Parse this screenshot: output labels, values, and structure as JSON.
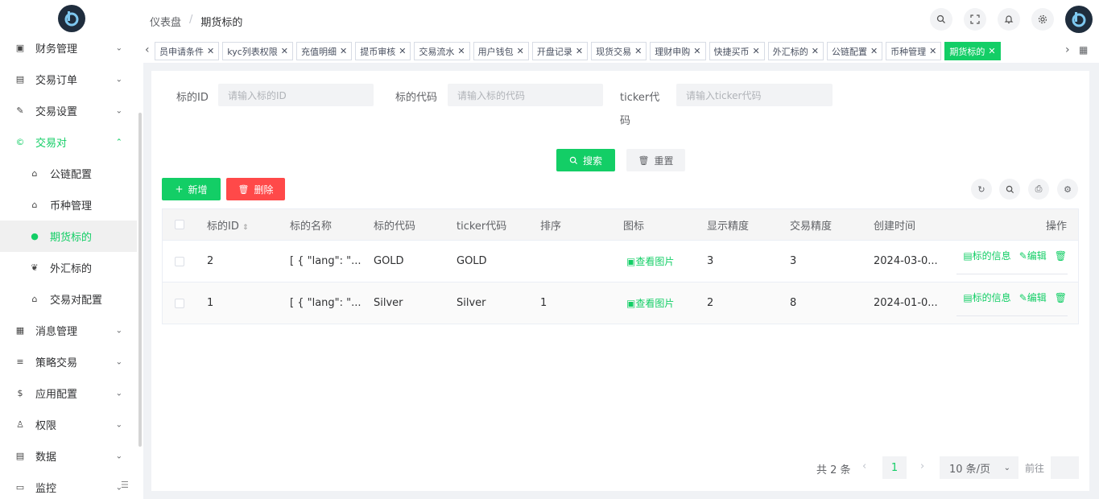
{
  "sidebar": {
    "items": [
      {
        "label": "财务管理",
        "icon": "finance-icon",
        "glyph": "▣"
      },
      {
        "label": "交易订单",
        "icon": "order-icon",
        "glyph": "▤"
      },
      {
        "label": "交易设置",
        "icon": "wrench-icon",
        "glyph": "✎"
      },
      {
        "label": "交易对",
        "icon": "copyright-icon",
        "glyph": "©"
      }
    ],
    "sub_items": [
      {
        "label": "公链配置",
        "icon": "home-icon",
        "glyph": "⌂"
      },
      {
        "label": "币种管理",
        "icon": "home-icon",
        "glyph": "⌂"
      },
      {
        "label": "期货标的",
        "icon": "circle-icon",
        "glyph": "●"
      },
      {
        "label": "外汇标的",
        "icon": "leaf-icon",
        "glyph": "❦"
      },
      {
        "label": "交易对配置",
        "icon": "home-icon",
        "glyph": "⌂"
      }
    ],
    "items_after": [
      {
        "label": "消息管理",
        "icon": "message-icon",
        "glyph": "▦"
      },
      {
        "label": "策略交易",
        "icon": "list-icon",
        "glyph": "≡"
      },
      {
        "label": "应用配置",
        "icon": "dollar-icon",
        "glyph": "$"
      },
      {
        "label": "权限",
        "icon": "user-icon",
        "glyph": "♙"
      },
      {
        "label": "数据",
        "icon": "data-icon",
        "glyph": "▤"
      },
      {
        "label": "监控",
        "icon": "monitor-icon",
        "glyph": "▭"
      }
    ],
    "accent": "#13ce66"
  },
  "breadcrumb": {
    "home": "仪表盘",
    "current": "期货标的"
  },
  "tags": [
    {
      "label": "员申请条件",
      "active": false
    },
    {
      "label": "kyc列表权限",
      "active": false
    },
    {
      "label": "充值明细",
      "active": false
    },
    {
      "label": "提币审核",
      "active": false
    },
    {
      "label": "交易流水",
      "active": false
    },
    {
      "label": "用户钱包",
      "active": false
    },
    {
      "label": "开盘记录",
      "active": false
    },
    {
      "label": "现货交易",
      "active": false
    },
    {
      "label": "理财申购",
      "active": false
    },
    {
      "label": "快捷买币",
      "active": false
    },
    {
      "label": "外汇标的",
      "active": false
    },
    {
      "label": "公链配置",
      "active": false
    },
    {
      "label": "币种管理",
      "active": false
    },
    {
      "label": "期货标的",
      "active": true
    }
  ],
  "filters": {
    "id_label": "标的ID",
    "id_placeholder": "请输入标的ID",
    "code_label": "标的代码",
    "code_placeholder": "请输入标的代码",
    "ticker_label_1": "ticker代",
    "ticker_label_2": "码",
    "ticker_placeholder": "请输入ticker代码",
    "search_label": "搜索",
    "reset_label": "重置"
  },
  "actions": {
    "add_label": "新增",
    "delete_label": "删除"
  },
  "table": {
    "headers": {
      "id": "标的ID",
      "name": "标的名称",
      "code": "标的代码",
      "ticker": "ticker代码",
      "sort": "排序",
      "icon": "图标",
      "display_precision": "显示精度",
      "trade_precision": "交易精度",
      "created": "创建时间",
      "ops": "操作"
    },
    "rows": [
      {
        "id": "2",
        "name": "[ { \"lang\": \"...",
        "code": "GOLD",
        "ticker": "GOLD",
        "sort": "",
        "icon_link": "查看图片",
        "display_precision": "3",
        "trade_precision": "3",
        "created": "2024-03-0...",
        "info": "标的信息",
        "edit": "编辑"
      },
      {
        "id": "1",
        "name": "[ { \"lang\": \"...",
        "code": "Silver",
        "ticker": "Silver",
        "sort": "1",
        "icon_link": "查看图片",
        "display_precision": "2",
        "trade_precision": "8",
        "created": "2024-01-0...",
        "info": "标的信息",
        "edit": "编辑"
      }
    ]
  },
  "pagination": {
    "total": "共 2 条",
    "current": "1",
    "page_size": "10 条/页",
    "goto": "前往"
  }
}
